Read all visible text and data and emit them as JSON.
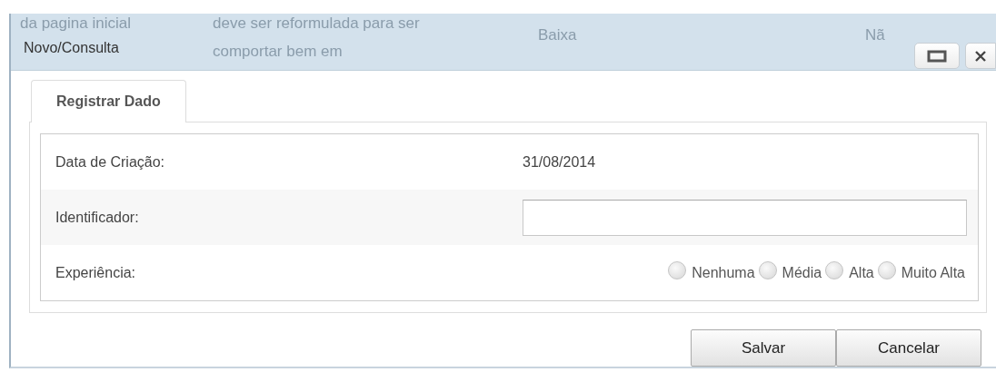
{
  "background_texts": [
    {
      "text": "da pagina inicial"
    },
    {
      "text": "deve ser reformulada para ser"
    },
    {
      "text": "comportar bem em"
    },
    {
      "text": "Baixa"
    },
    {
      "text": "Nã"
    }
  ],
  "window": {
    "title": "Novo/Consulta"
  },
  "tabs": [
    {
      "label": "Registrar Dado",
      "selected": true
    }
  ],
  "form": {
    "rows": [
      {
        "kind": "text",
        "label": "Data de Criação:",
        "value": "31/08/2014"
      },
      {
        "kind": "input",
        "label": "Identificador:"
      },
      {
        "kind": "radio",
        "label": "Experiência:",
        "options": [
          {
            "label": "Nenhuma",
            "selected": false
          },
          {
            "label": "Média",
            "selected": false
          },
          {
            "label": "Alta",
            "selected": false
          },
          {
            "label": "Muito Alta",
            "selected": false
          }
        ]
      }
    ]
  },
  "buttons": [
    "Salvar",
    "Cancelar"
  ]
}
